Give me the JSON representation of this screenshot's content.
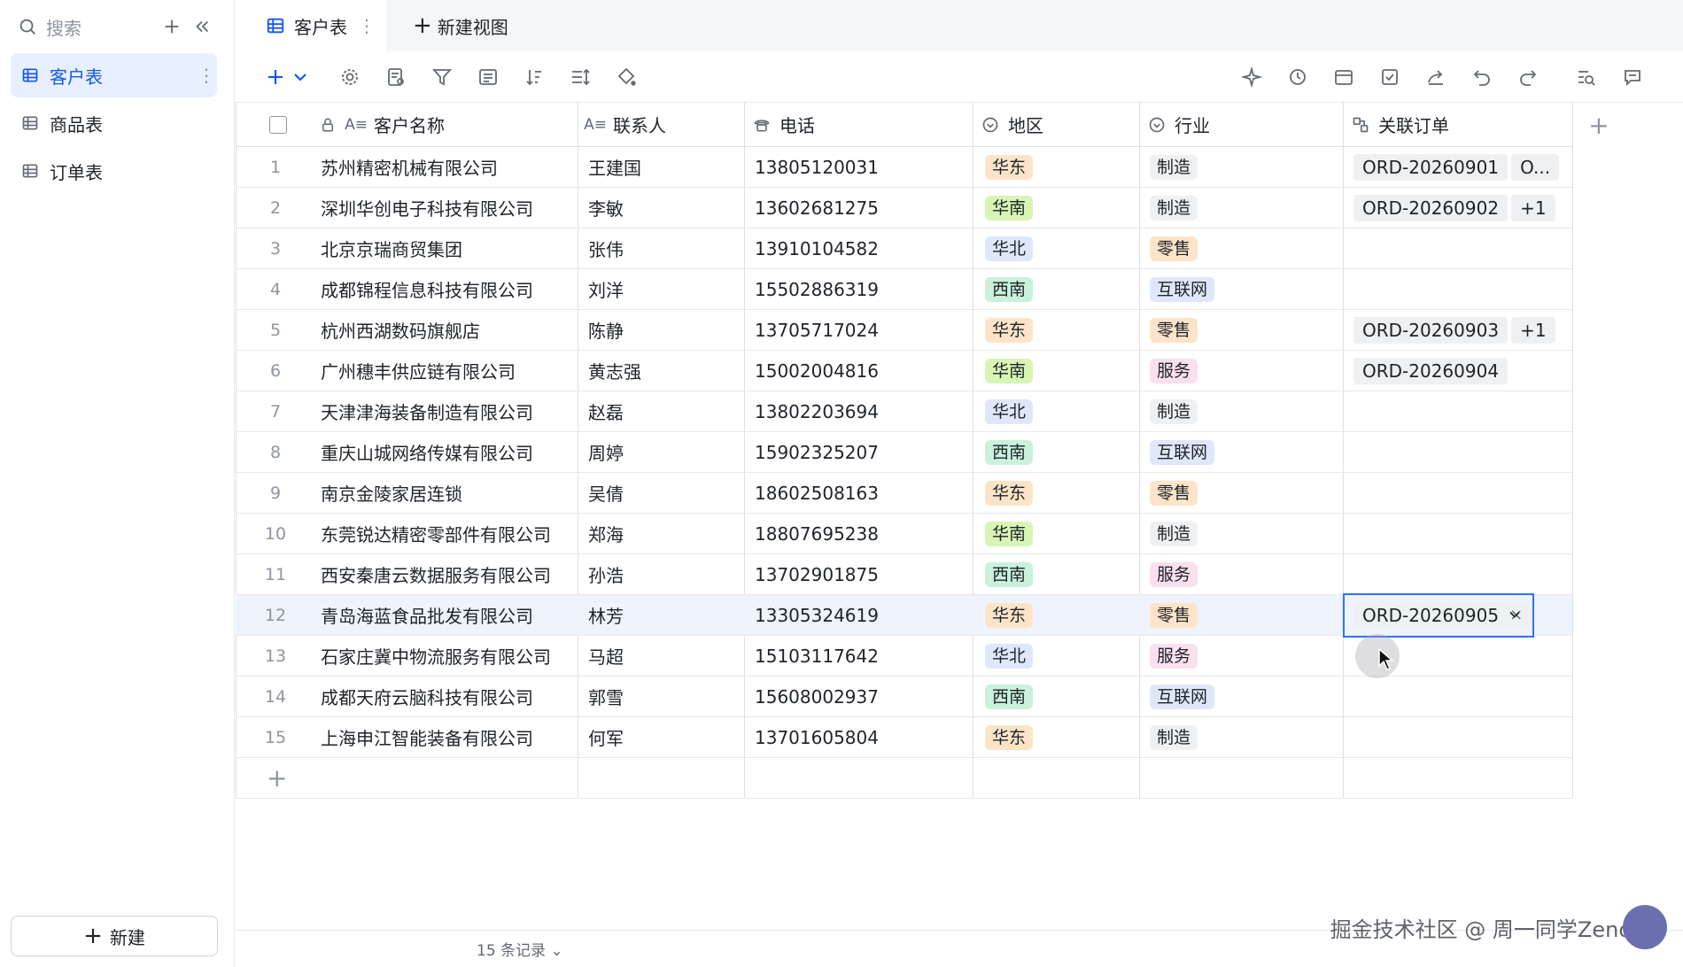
{
  "sidebar": {
    "search_placeholder": "搜索",
    "items": [
      {
        "label": "客户表",
        "active": true
      },
      {
        "label": "商品表",
        "active": false
      },
      {
        "label": "订单表",
        "active": false
      }
    ],
    "new_label": "新建"
  },
  "tabs": {
    "active_label": "客户表",
    "new_view_label": "新建视图"
  },
  "table": {
    "columns": [
      "客户名称",
      "联系人",
      "电话",
      "地区",
      "行业",
      "关联订单"
    ],
    "rows": [
      {
        "no": "1",
        "name": "苏州精密机械有限公司",
        "contact": "王建国",
        "phone": "13805120031",
        "region": "华东",
        "industry": "制造",
        "orders": [
          "ORD-20260901",
          "O..."
        ]
      },
      {
        "no": "2",
        "name": "深圳华创电子科技有限公司",
        "contact": "李敏",
        "phone": "13602681275",
        "region": "华南",
        "industry": "制造",
        "orders": [
          "ORD-20260902",
          "+1"
        ]
      },
      {
        "no": "3",
        "name": "北京京瑞商贸集团",
        "contact": "张伟",
        "phone": "13910104582",
        "region": "华北",
        "industry": "零售",
        "orders": []
      },
      {
        "no": "4",
        "name": "成都锦程信息科技有限公司",
        "contact": "刘洋",
        "phone": "15502886319",
        "region": "西南",
        "industry": "互联网",
        "orders": []
      },
      {
        "no": "5",
        "name": "杭州西湖数码旗舰店",
        "contact": "陈静",
        "phone": "13705717024",
        "region": "华东",
        "industry": "零售",
        "orders": [
          "ORD-20260903",
          "+1"
        ]
      },
      {
        "no": "6",
        "name": "广州穗丰供应链有限公司",
        "contact": "黄志强",
        "phone": "15002004816",
        "region": "华南",
        "industry": "服务",
        "orders": [
          "ORD-20260904"
        ]
      },
      {
        "no": "7",
        "name": "天津津海装备制造有限公司",
        "contact": "赵磊",
        "phone": "13802203694",
        "region": "华北",
        "industry": "制造",
        "orders": []
      },
      {
        "no": "8",
        "name": "重庆山城网络传媒有限公司",
        "contact": "周婷",
        "phone": "15902325207",
        "region": "西南",
        "industry": "互联网",
        "orders": []
      },
      {
        "no": "9",
        "name": "南京金陵家居连锁",
        "contact": "吴倩",
        "phone": "18602508163",
        "region": "华东",
        "industry": "零售",
        "orders": []
      },
      {
        "no": "10",
        "name": "东莞锐达精密零部件有限公司",
        "contact": "郑海",
        "phone": "18807695238",
        "region": "华南",
        "industry": "制造",
        "orders": []
      },
      {
        "no": "11",
        "name": "西安秦唐云数据服务有限公司",
        "contact": "孙浩",
        "phone": "13702901875",
        "region": "西南",
        "industry": "服务",
        "orders": []
      },
      {
        "no": "12",
        "name": "青岛海蓝食品批发有限公司",
        "contact": "林芳",
        "phone": "13305324619",
        "region": "华东",
        "industry": "零售",
        "orders": [
          "ORD-20260905"
        ],
        "selected": true
      },
      {
        "no": "13",
        "name": "石家庄冀中物流服务有限公司",
        "contact": "马超",
        "phone": "15103117642",
        "region": "华北",
        "industry": "服务",
        "orders": []
      },
      {
        "no": "14",
        "name": "成都天府云脑科技有限公司",
        "contact": "郭雪",
        "phone": "15608002937",
        "region": "西南",
        "industry": "互联网",
        "orders": []
      },
      {
        "no": "15",
        "name": "上海申江智能装备有限公司",
        "contact": "何军",
        "phone": "13701605804",
        "region": "华东",
        "industry": "制造",
        "orders": []
      }
    ]
  },
  "tag_colors": {
    "华东": "#fde4c8",
    "华南": "#d8f5b5",
    "华北": "#dfe7fb",
    "西南": "#c9f1dc",
    "制造": "#eff0f1",
    "零售": "#fde4c8",
    "互联网": "#dfe7fb",
    "服务": "#fbe0ee"
  },
  "footer": {
    "record_count": "15 条记录"
  },
  "watermark": "掘金技术社区 @ 周一同学Zeno"
}
